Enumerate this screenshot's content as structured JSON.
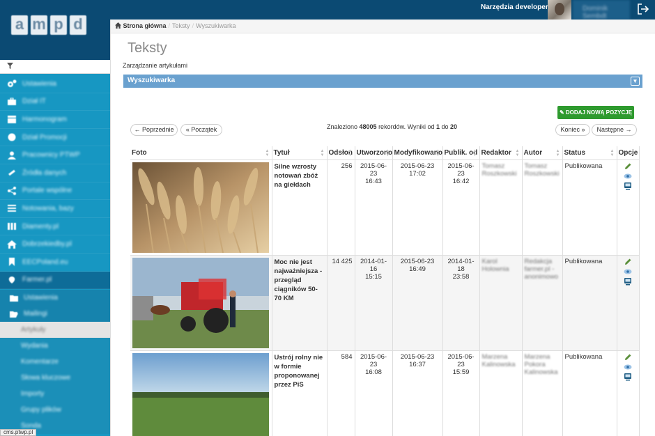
{
  "top": {
    "dev_tools": "Narzędzia developerskie",
    "username": "Dominik Sembdt"
  },
  "sidebar": {
    "logo_letters": [
      "a",
      "m",
      "p",
      "d"
    ],
    "items": [
      {
        "label": "Ustawienia",
        "icon": "gears-icon"
      },
      {
        "label": "Dział IT",
        "icon": "briefcase-icon"
      },
      {
        "label": "Harmonogram",
        "icon": "calendar-icon"
      },
      {
        "label": "Dział Promocji",
        "icon": "globe-icon"
      },
      {
        "label": "Pracownicy PTWP",
        "icon": "user-icon"
      },
      {
        "label": "Źródła danych",
        "icon": "link-icon"
      },
      {
        "label": "Portale wspólne",
        "icon": "share-icon"
      },
      {
        "label": "Notowania, bazy",
        "icon": "list-icon"
      },
      {
        "label": "Diamenty.pl",
        "icon": "columns-icon"
      },
      {
        "label": "Dobrzekiedby.pl",
        "icon": "home-icon"
      },
      {
        "label": "EECPoland.eu",
        "icon": "bookmark-icon"
      },
      {
        "label": "Farmer.pl",
        "icon": "leaf-icon"
      }
    ],
    "sub_items": [
      {
        "label": "Ustawienia"
      },
      {
        "label": "Mailingi"
      }
    ],
    "sub_sub_items": [
      {
        "label": "Artykuły"
      },
      {
        "label": "Wydania"
      },
      {
        "label": "Komentarze"
      },
      {
        "label": "Słowa kluczowe"
      },
      {
        "label": "Importy"
      },
      {
        "label": "Grupy plików"
      },
      {
        "label": "Sonda"
      }
    ]
  },
  "status_url": "cms.ptwp.pl",
  "breadcrumb": {
    "home": "Strona główna",
    "items": [
      "Teksty",
      "Wyszukiwarka"
    ]
  },
  "page": {
    "title": "Teksty",
    "subtitle": "Zarządzanie artykułami",
    "search_panel": "Wyszukiwarka",
    "add_button": "DODAJ NOWĄ POZYCJĘ"
  },
  "pagination": {
    "prev": "← Poprzednie",
    "first": "« Początek",
    "found_prefix": "Znaleziono ",
    "found_count": "48005",
    "found_mid": " rekordów. Wyniki od ",
    "from": "1",
    "to_word": " do ",
    "to": "20",
    "end": "Koniec »",
    "next": "Następne →"
  },
  "table": {
    "headers": [
      "Foto",
      "Tytuł",
      "Odsłon",
      "Utworzono",
      "Modyfikowano",
      "Publik. od",
      "Redaktor",
      "Autor",
      "Status",
      "Opcje"
    ],
    "rows": [
      {
        "title": "Silne wzrosty notowań zbóż na giełdach",
        "views": "256",
        "created_date": "2015-06-23",
        "created_time": "16:43",
        "modified_date": "2015-06-23",
        "modified_time": "17:02",
        "published_date": "2015-06-23",
        "published_time": "16:42",
        "editor": "Tomasz Roszkowski",
        "author": "Tomasz Roszkowski",
        "status": "Publikowana",
        "photo": "wheat"
      },
      {
        "title": "Moc nie jest najważniejsza - przegląd ciągników 50-70 KM",
        "views": "14 425",
        "created_date": "2014-01-16",
        "created_time": "15:15",
        "modified_date": "2015-06-23",
        "modified_time": "16:49",
        "published_date": "2014-01-18",
        "published_time": "23:58",
        "editor": "Karol Holownia",
        "author": "Redakcja farmer.pl - anonimowo",
        "status": "Publikowana",
        "photo": "tractor"
      },
      {
        "title": "Ustrój rolny nie w formie proponowanej przez PiS",
        "views": "584",
        "created_date": "2015-06-23",
        "created_time": "16:08",
        "modified_date": "2015-06-23",
        "modified_time": "16:37",
        "published_date": "2015-06-23",
        "published_time": "15:59",
        "editor": "Marzena Kalinowska",
        "author": "Marzena Pokora Kalinowska",
        "status": "Publikowana",
        "photo": "field"
      }
    ]
  },
  "colors": {
    "topbar": "#0b4a73",
    "sidebar": "#1797c2",
    "panel": "#6aa1cf",
    "add_button": "#2e9a2e"
  }
}
